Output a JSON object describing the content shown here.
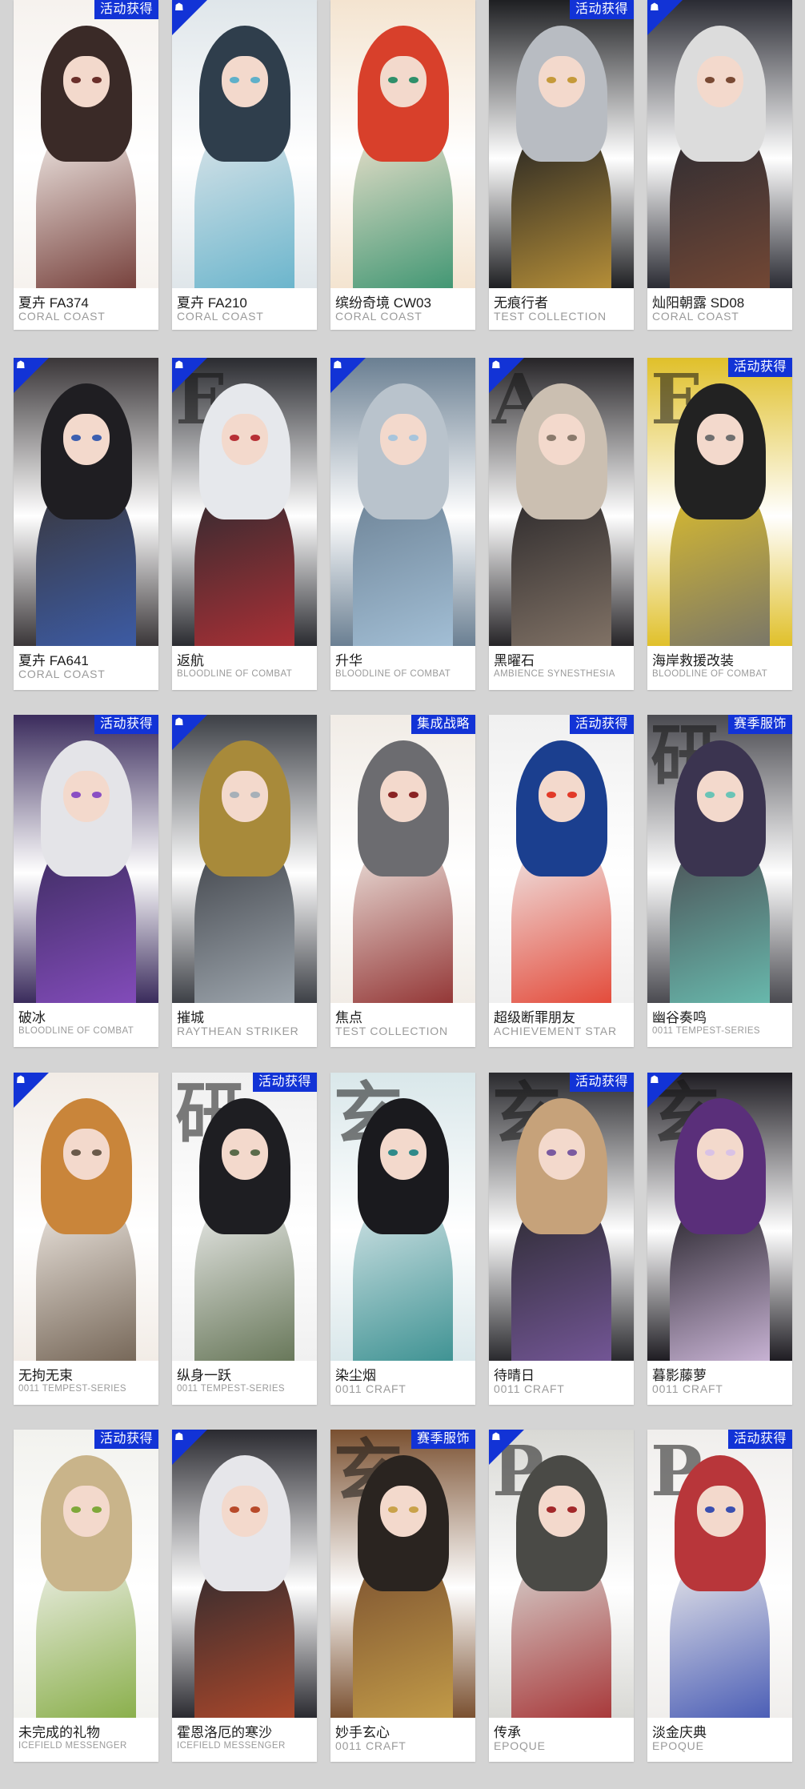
{
  "labels": {
    "event": "活动获得",
    "integrated": "集成战略",
    "season": "赛季服饰"
  },
  "colors": {
    "accent": "#1233d6",
    "background": "#d4d4d4",
    "card": "#ffffff"
  },
  "cards": [
    {
      "name": "夏卉 FA374",
      "series": "CORAL COAST",
      "tag": "活动获得",
      "badge": false,
      "palette": [
        "#3a2a27",
        "#f6f2ee",
        "#6a2f2a"
      ],
      "bgword": ""
    },
    {
      "name": "夏卉 FA210",
      "series": "CORAL COAST",
      "tag": "",
      "badge": true,
      "palette": [
        "#2f3e4c",
        "#dfe6ea",
        "#5fb0c9"
      ],
      "bgword": ""
    },
    {
      "name": "缤纷奇境 CW03",
      "series": "CORAL COAST",
      "tag": "",
      "badge": false,
      "palette": [
        "#d8402b",
        "#f4e4d0",
        "#2f8f6a"
      ],
      "bgword": ""
    },
    {
      "name": "无痕行者",
      "series": "TEST COLLECTION",
      "tag": "活动获得",
      "badge": false,
      "palette": [
        "#b8bcc2",
        "#1e1f22",
        "#c59a3a"
      ],
      "bgword": ""
    },
    {
      "name": "灿阳朝露 SD08",
      "series": "CORAL COAST",
      "tag": "",
      "badge": true,
      "palette": [
        "#dcdcdc",
        "#2a2b33",
        "#7a4a34"
      ],
      "bgword": ""
    },
    {
      "name": "夏卉 FA641",
      "series": "CORAL COAST",
      "tag": "",
      "badge": true,
      "palette": [
        "#1f1e22",
        "#3a3638",
        "#3c5fb0"
      ],
      "bgword": ""
    },
    {
      "name": "返航",
      "series": "BLOODLINE OF COMBAT",
      "tag": "",
      "badge": true,
      "palette": [
        "#e6e8ec",
        "#2a2b30",
        "#b73036"
      ],
      "bgword": "F"
    },
    {
      "name": "升华",
      "series": "BLOODLINE OF COMBAT",
      "tag": "",
      "badge": true,
      "palette": [
        "#b9c3cc",
        "#6a7f92",
        "#a8c5dc"
      ],
      "bgword": ""
    },
    {
      "name": "黑曜石",
      "series": "AMBIENCE SYNESTHESIA",
      "tag": "",
      "badge": true,
      "palette": [
        "#cbbfb1",
        "#262427",
        "#8a7a6c"
      ],
      "bgword": "A"
    },
    {
      "name": "海岸救援改装",
      "series": "BLOODLINE OF COMBAT",
      "tag": "活动获得",
      "badge": false,
      "palette": [
        "#222222",
        "#e0c02a",
        "#6f6f6f"
      ],
      "bgword": "F"
    },
    {
      "name": "破冰",
      "series": "BLOODLINE OF COMBAT",
      "tag": "活动获得",
      "badge": false,
      "palette": [
        "#e4e4e8",
        "#3a2b5c",
        "#8a4fc4"
      ],
      "bgword": ""
    },
    {
      "name": "摧城",
      "series": "RAYTHEAN STRIKER",
      "tag": "",
      "badge": true,
      "palette": [
        "#a88a3a",
        "#3d4046",
        "#a7b0b8"
      ],
      "bgword": ""
    },
    {
      "name": "焦点",
      "series": "TEST COLLECTION",
      "tag": "集成战略",
      "badge": false,
      "palette": [
        "#6c6c70",
        "#f1ece6",
        "#8a2424"
      ],
      "bgword": ""
    },
    {
      "name": "超级断罪朋友",
      "series": "ACHIEVEMENT STAR",
      "tag": "活动获得",
      "badge": false,
      "palette": [
        "#1b3f8f",
        "#f0f0f0",
        "#e23a28"
      ],
      "bgword": ""
    },
    {
      "name": "幽谷奏鸣",
      "series": "0011 TEMPEST-SERIES",
      "tag": "赛季服饰",
      "badge": false,
      "palette": [
        "#3b3450",
        "#4a4a50",
        "#6bc4b6"
      ],
      "bgword": "研"
    },
    {
      "name": "无拘无束",
      "series": "0011 TEMPEST-SERIES",
      "tag": "",
      "badge": true,
      "palette": [
        "#c9853a",
        "#f2ece6",
        "#6a5a4a"
      ],
      "bgword": ""
    },
    {
      "name": "纵身一跃",
      "series": "0011 TEMPEST-SERIES",
      "tag": "活动获得",
      "badge": false,
      "palette": [
        "#1e1e22",
        "#f0f0f0",
        "#5a6b4a"
      ],
      "bgword": "研"
    },
    {
      "name": "染尘烟",
      "series": "0011 CRAFT",
      "tag": "",
      "badge": false,
      "palette": [
        "#1a1a1e",
        "#d9e7ea",
        "#2f8a8a"
      ],
      "bgword": "玄"
    },
    {
      "name": "待晴日",
      "series": "0011 CRAFT",
      "tag": "活动获得",
      "badge": false,
      "palette": [
        "#c6a27a",
        "#2a2a2e",
        "#7a5aa0"
      ],
      "bgword": "玄"
    },
    {
      "name": "暮影藤萝",
      "series": "0011 CRAFT",
      "tag": "",
      "badge": true,
      "palette": [
        "#5a2f7a",
        "#1e1c22",
        "#d9c2e6"
      ],
      "bgword": "玄"
    },
    {
      "name": "未完成的礼物",
      "series": "ICEFIELD MESSENGER",
      "tag": "活动获得",
      "badge": false,
      "palette": [
        "#c9b48a",
        "#f2f2ee",
        "#7fa83a"
      ],
      "bgword": ""
    },
    {
      "name": "霍恩洛厄的寒沙",
      "series": "ICEFIELD MESSENGER",
      "tag": "",
      "badge": true,
      "palette": [
        "#e6e6ea",
        "#2a2a30",
        "#b84a2a"
      ],
      "bgword": ""
    },
    {
      "name": "妙手玄心",
      "series": "0011 CRAFT",
      "tag": "赛季服饰",
      "badge": false,
      "palette": [
        "#2a2420",
        "#7a5030",
        "#c9a24a"
      ],
      "bgword": "玄"
    },
    {
      "name": "传承",
      "series": "EPOQUE",
      "tag": "",
      "badge": true,
      "palette": [
        "#4a4a46",
        "#d8d8d4",
        "#a3282a"
      ],
      "bgword": "P"
    },
    {
      "name": "淡金庆典",
      "series": "EPOQUE",
      "tag": "活动获得",
      "badge": false,
      "palette": [
        "#b8363a",
        "#f0eeec",
        "#3a4fb0"
      ],
      "bgword": "P"
    }
  ]
}
